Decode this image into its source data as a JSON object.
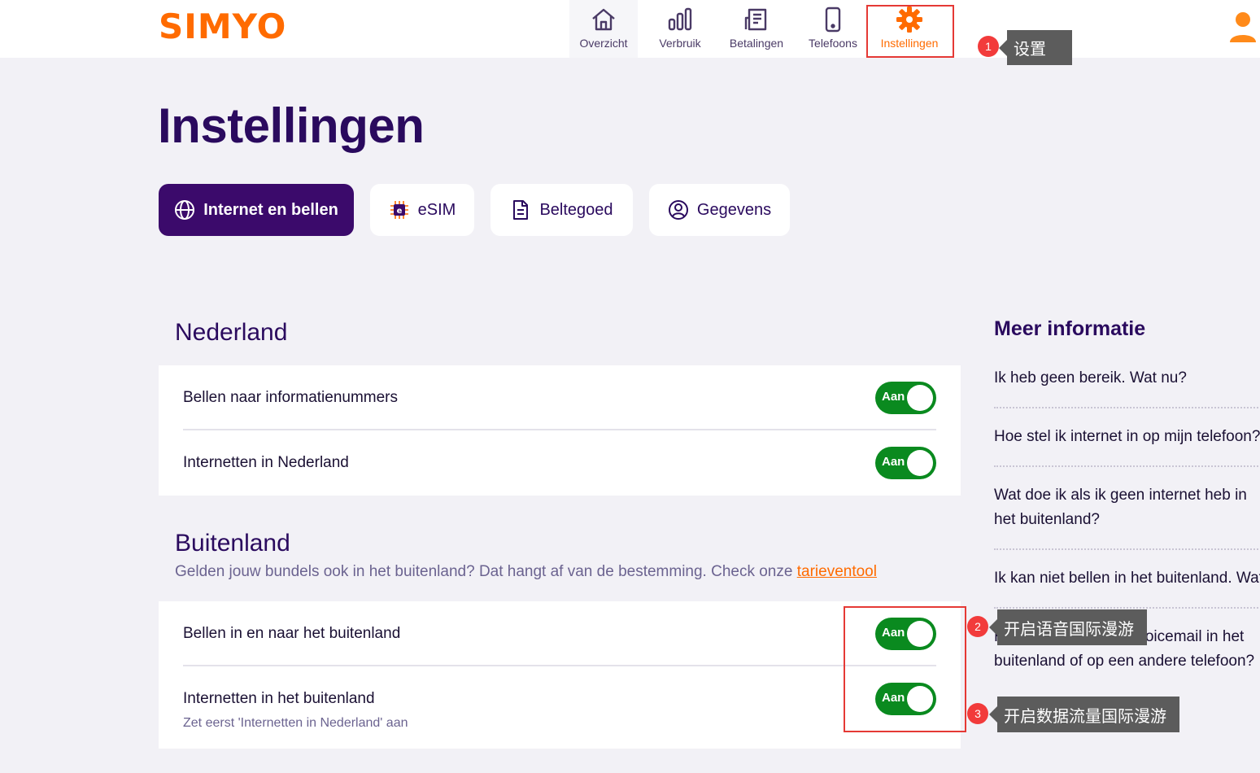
{
  "header": {
    "logo": "SIMYO",
    "nav": [
      {
        "label": "Overzicht",
        "icon": "home-icon"
      },
      {
        "label": "Verbruik",
        "icon": "bar-chart-icon"
      },
      {
        "label": "Betalingen",
        "icon": "invoice-icon"
      },
      {
        "label": "Telefoons",
        "icon": "phone-icon"
      },
      {
        "label": "Instellingen",
        "icon": "gear-icon",
        "active": true
      }
    ],
    "user_icon": "user-icon"
  },
  "annotations": [
    {
      "number": "1",
      "text": "设置"
    },
    {
      "number": "2",
      "text": "开启语音国际漫游"
    },
    {
      "number": "3",
      "text": "开启数据流量国际漫游"
    }
  ],
  "page_title": "Instellingen",
  "tabs": [
    {
      "label": "Internet en bellen",
      "icon": "globe-icon",
      "active": true
    },
    {
      "label": "eSIM",
      "icon": "esim-chip-icon"
    },
    {
      "label": "Beltegoed",
      "icon": "document-icon"
    },
    {
      "label": "Gegevens",
      "icon": "user-circle-icon"
    }
  ],
  "nederland": {
    "title": "Nederland",
    "rows": [
      {
        "label": "Bellen naar informatienummers",
        "toggle": "Aan",
        "on": true
      },
      {
        "label": "Internetten in Nederland",
        "toggle": "Aan",
        "on": true
      }
    ]
  },
  "buitenland": {
    "title": "Buitenland",
    "subtitle": "Gelden jouw bundels ook in het buitenland? Dat hangt af van de bestemming. Check onze ",
    "link": "tarieventool",
    "rows": [
      {
        "label": "Bellen in en naar het buitenland",
        "toggle": "Aan",
        "on": true
      },
      {
        "label": "Internetten in het buitenland",
        "hint": "Zet eerst 'Internetten in Nederland' aan",
        "toggle": "Aan",
        "on": true
      }
    ]
  },
  "side": {
    "title": "Meer informatie",
    "links": [
      "Ik heb geen bereik. Wat nu?",
      "Hoe stel ik internet in op mijn telefoon?",
      "Wat doe ik als ik geen internet heb in het buitenland?",
      "Ik kan niet bellen in het buitenland. Wat nu?",
      "Hoe beluister ik mijn voicemail in het buitenland of op een andere telefoon?"
    ]
  },
  "colors": {
    "brand_orange": "#ff6b00",
    "brand_purple": "#3b0a6b",
    "toggle_green": "#0a8a1f",
    "annotation_red": "#e53935"
  }
}
